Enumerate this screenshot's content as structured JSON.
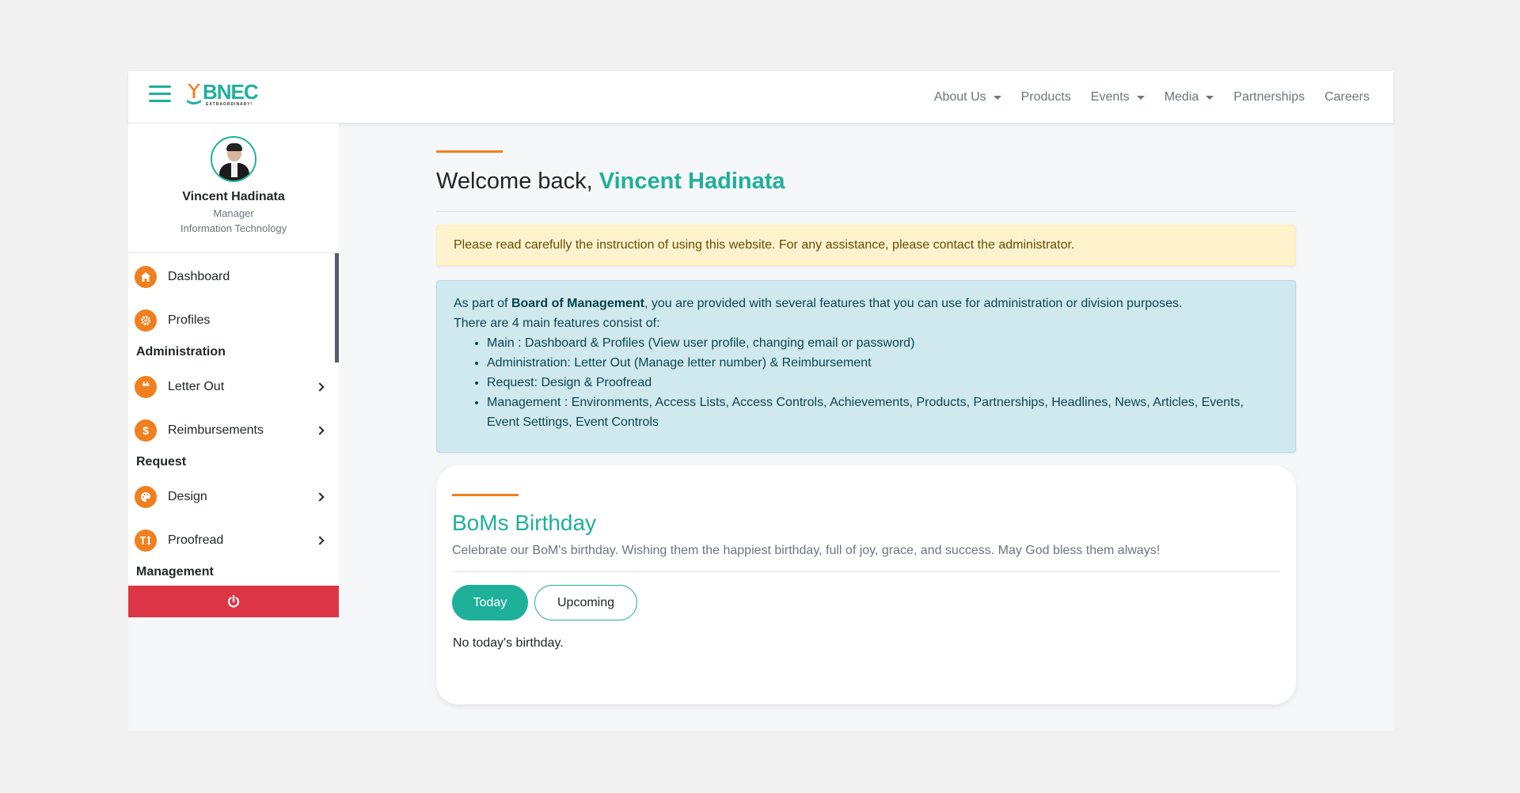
{
  "brand": {
    "name": "BNEC",
    "tagline": "EXTRAORDINARY!",
    "accent_color": "#1fb09a",
    "secondary_color": "#f07f1f"
  },
  "nav": {
    "links": [
      {
        "label": "About Us",
        "dropdown": true
      },
      {
        "label": "Products",
        "dropdown": false
      },
      {
        "label": "Events",
        "dropdown": true
      },
      {
        "label": "Media",
        "dropdown": true
      },
      {
        "label": "Partnerships",
        "dropdown": false
      },
      {
        "label": "Careers",
        "dropdown": false
      }
    ]
  },
  "profile": {
    "name": "Vincent Hadinata",
    "role": "Manager",
    "division": "Information Technology"
  },
  "sidebar": {
    "items": [
      {
        "label": "Dashboard",
        "icon": "home-icon"
      },
      {
        "label": "Profiles",
        "icon": "gear-icon"
      }
    ],
    "sections": [
      {
        "heading": "Administration",
        "items": [
          {
            "label": "Letter Out",
            "icon": "quote-icon"
          },
          {
            "label": "Reimbursements",
            "icon": "dollar-icon"
          }
        ]
      },
      {
        "heading": "Request",
        "items": [
          {
            "label": "Design",
            "icon": "palette-icon"
          },
          {
            "label": "Proofread",
            "icon": "text-height-icon"
          }
        ]
      },
      {
        "heading": "Management",
        "items": []
      }
    ],
    "logout_color": "#dc3545"
  },
  "main": {
    "welcome_prefix": "Welcome back,",
    "welcome_name": "Vincent Hadinata",
    "warning": "Please read carefully the instruction of using this website. For any assistance, please contact the administrator.",
    "info": {
      "intro_before": "As part of",
      "intro_bold": "Board of Management",
      "intro_after": ", you are provided with several features that you can use for administration or division purposes.",
      "line2": "There are 4 main features consist of:",
      "features": [
        "Main : Dashboard & Profiles (View user profile, changing email or password)",
        "Administration: Letter Out (Manage letter number) & Reimbursement",
        "Request: Design & Proofread",
        "Management : Environments, Access Lists, Access Controls, Achievements, Products, Partnerships, Headlines, News, Articles, Events, Event Settings, Event Controls"
      ]
    },
    "birthday": {
      "title": "BoMs Birthday",
      "subtitle": "Celebrate our BoM's birthday. Wishing them the happiest birthday, full of joy, grace, and success. May God bless them always!",
      "tab_today": "Today",
      "tab_upcoming": "Upcoming",
      "empty": "No today's birthday."
    }
  }
}
